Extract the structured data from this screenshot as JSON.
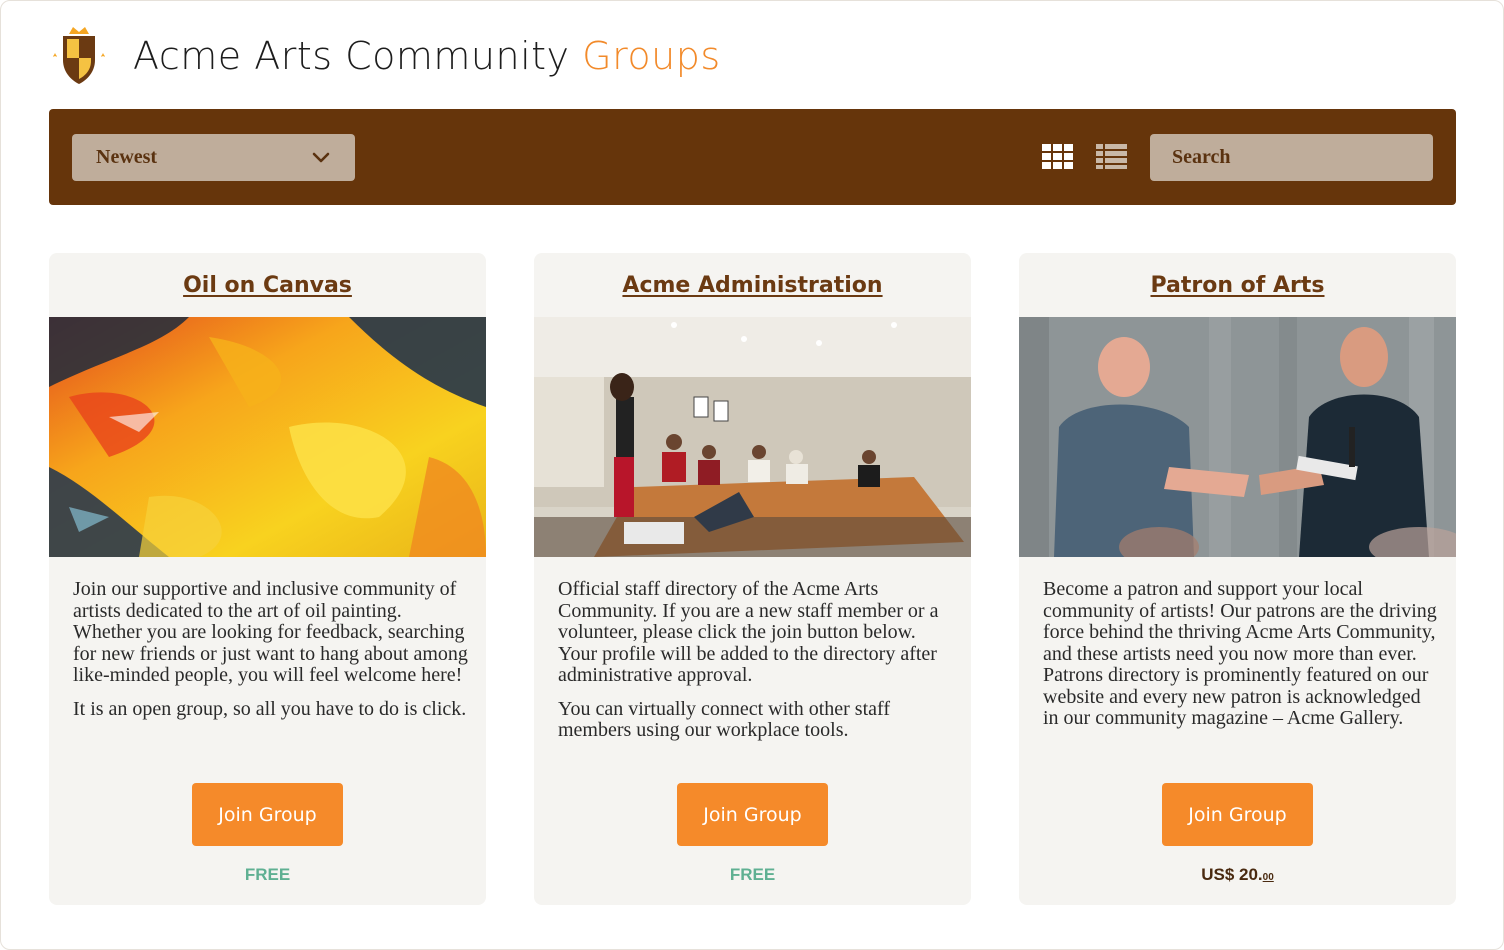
{
  "app": {
    "title_main": "Acme Arts Community",
    "title_accent": "Groups",
    "logo_icon": "shield-crown-icon"
  },
  "toolbar": {
    "sort_selected": "Newest",
    "sort_icon": "chevron-down-icon",
    "grid_view_icon": "grid-view-icon",
    "list_view_icon": "list-view-icon",
    "search_placeholder": "Search"
  },
  "colors": {
    "toolbar_bg": "#66350b",
    "accent": "#f28a2a",
    "button": "#f58a2a",
    "free_price": "#5fb092",
    "card_bg": "#f5f4f1"
  },
  "groups": [
    {
      "title": "Oil on Canvas",
      "image": "abstract-oil-painting",
      "paragraphs": [
        "Join our supportive and inclusive community of artists dedicated to the art of oil painting. Whether you are looking for feedback, searching for new friends or just want to hang about among like-minded people, you will feel welcome here!",
        "It is an open group, so all you have to do is click."
      ],
      "button": "Join Group",
      "price": "FREE"
    },
    {
      "title": "Acme Administration",
      "image": "meeting-room-photo",
      "paragraphs": [
        "Official staff directory of the Acme Arts Community. If you are a new staff member or a volunteer, please click the join button below. Your profile will be added to the directory after administrative approval.",
        "You can virtually connect with other staff members using our workplace tools."
      ],
      "button": "Join Group",
      "price": "FREE"
    },
    {
      "title": "Patron of Arts",
      "image": "handshake-photo",
      "paragraphs": [
        "Become a patron and support your local community of artists! Our patrons are the driving force behind the thriving Acme Arts Community, and these artists need you now more than ever. Patrons directory is prominently featured on our website and every new patron is acknowledged in our community magazine – Acme Gallery."
      ],
      "button": "Join Group",
      "price_main": "US$ 20.",
      "price_cents": "00"
    }
  ]
}
